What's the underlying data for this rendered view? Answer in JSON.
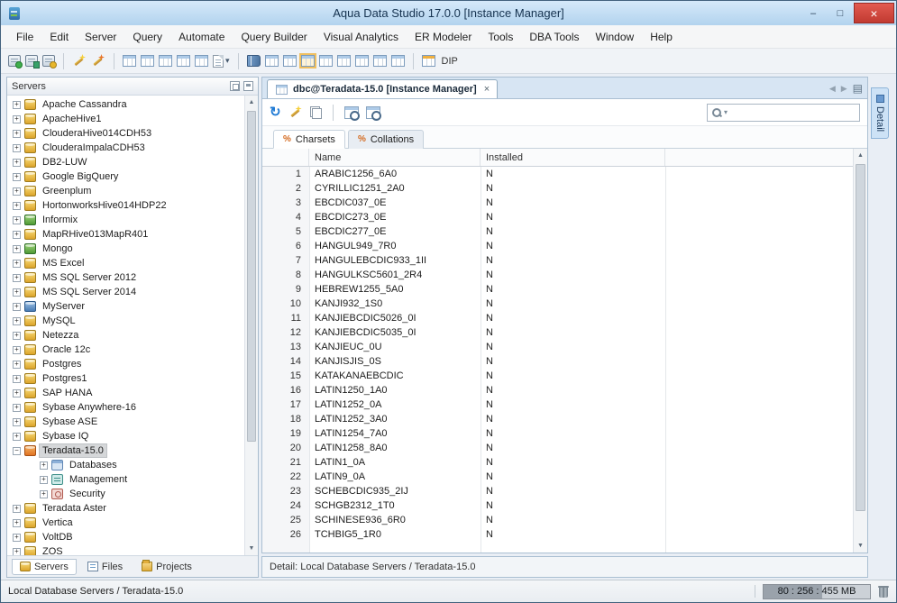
{
  "window": {
    "title": "Aqua Data Studio 17.0.0 [Instance Manager]",
    "controls": {
      "minimize": "–",
      "maximize": "□",
      "close": "×"
    }
  },
  "colors": {
    "titlebar": "#b8d6f0",
    "close_button": "#c9403a",
    "accent_blue": "#1f7ad4",
    "selection_gray": "#d5d7d9",
    "db_icon_yellow": "#dca42a",
    "detail_tab_blue": "#cde2f6"
  },
  "menu": {
    "items": [
      "File",
      "Edit",
      "Server",
      "Query",
      "Automate",
      "Query Builder",
      "Visual Analytics",
      "ER Modeler",
      "Tools",
      "DBA Tools",
      "Window",
      "Help"
    ]
  },
  "toolbar": {
    "dip_label": "DIP",
    "items": [
      {
        "name": "register-server-icon",
        "cls": "ico-server g"
      },
      {
        "name": "connect-server-icon",
        "cls": "ico-server f"
      },
      {
        "name": "server-properties-icon",
        "cls": "ico-server y"
      },
      {
        "type": "sep"
      },
      {
        "name": "query-analyzer-icon",
        "cls": "ico-wand"
      },
      {
        "name": "query-builder-icon",
        "cls": "ico-wand w2"
      },
      {
        "type": "sep"
      },
      {
        "name": "schema-browser-icon",
        "cls": "ico-grid"
      },
      {
        "name": "table-data-icon",
        "cls": "ico-grid"
      },
      {
        "name": "results-grid-icon",
        "cls": "ico-grid"
      },
      {
        "name": "pivot-grid-icon",
        "cls": "ico-grid"
      },
      {
        "name": "export-grid-icon",
        "cls": "ico-grid"
      },
      {
        "name": "new-document-icon",
        "cls": "ico-doc"
      },
      {
        "type": "caret",
        "name": "new-document-dropdown-caret"
      },
      {
        "type": "sep"
      },
      {
        "name": "instance-manager-icon",
        "cls": "ico-book"
      },
      {
        "name": "storage-view-icon",
        "cls": "ico-grid"
      },
      {
        "name": "sessions-view-icon",
        "cls": "ico-grid"
      },
      {
        "name": "security-view-icon",
        "cls": "ico-grid sel"
      },
      {
        "name": "charsets-view-icon",
        "cls": "ico-grid"
      },
      {
        "name": "collations-view-icon",
        "cls": "ico-grid"
      },
      {
        "name": "statistics-view-icon",
        "cls": "ico-grid"
      },
      {
        "name": "logs-view-icon",
        "cls": "ico-grid"
      },
      {
        "name": "configuration-view-icon",
        "cls": "ico-grid"
      },
      {
        "type": "sep"
      },
      {
        "name": "dip-icon",
        "cls": "ico-grid dipico"
      },
      {
        "type": "label"
      }
    ]
  },
  "sidebar": {
    "title": "Servers",
    "tree": [
      {
        "label": "Apache Cassandra",
        "icon": "db-yellow"
      },
      {
        "label": "ApacheHive1",
        "icon": "db-yellow"
      },
      {
        "label": "ClouderaHive014CDH53",
        "icon": "db-yellow"
      },
      {
        "label": "ClouderaImpalaCDH53",
        "icon": "db-yellow"
      },
      {
        "label": "DB2-LUW",
        "icon": "db-yellow"
      },
      {
        "label": "Google BigQuery",
        "icon": "db-yellow"
      },
      {
        "label": "Greenplum",
        "icon": "db-yellow"
      },
      {
        "label": "HortonworksHive014HDP22",
        "icon": "db-yellow"
      },
      {
        "label": "Informix",
        "icon": "db-green"
      },
      {
        "label": "MapRHive013MapR401",
        "icon": "db-yellow"
      },
      {
        "label": "Mongo",
        "icon": "db-green"
      },
      {
        "label": "MS Excel",
        "icon": "db-yellow"
      },
      {
        "label": "MS SQL Server 2012",
        "icon": "db-yellow"
      },
      {
        "label": "MS SQL Server 2014",
        "icon": "db-yellow"
      },
      {
        "label": "MyServer",
        "icon": "db-blue"
      },
      {
        "label": "MySQL",
        "icon": "db-yellow"
      },
      {
        "label": "Netezza",
        "icon": "db-yellow"
      },
      {
        "label": "Oracle 12c",
        "icon": "db-yellow"
      },
      {
        "label": "Postgres",
        "icon": "db-yellow"
      },
      {
        "label": "Postgres1",
        "icon": "db-yellow"
      },
      {
        "label": "SAP HANA",
        "icon": "db-yellow"
      },
      {
        "label": "Sybase Anywhere-16",
        "icon": "db-yellow"
      },
      {
        "label": "Sybase ASE",
        "icon": "db-yellow"
      },
      {
        "label": "Sybase IQ",
        "icon": "db-yellow"
      },
      {
        "label": "Teradata-15.0",
        "icon": "db-orange",
        "expander": "minus",
        "selected": true
      },
      {
        "label": "Databases",
        "icon": "folder-blue",
        "level": 1
      },
      {
        "label": "Management",
        "icon": "folder-teal",
        "level": 1
      },
      {
        "label": "Security",
        "icon": "folder-red",
        "level": 1
      },
      {
        "label": "Teradata Aster",
        "icon": "db-yellow"
      },
      {
        "label": "Vertica",
        "icon": "db-yellow"
      },
      {
        "label": "VoltDB",
        "icon": "db-yellow"
      },
      {
        "label": "ZOS",
        "icon": "db-yellow"
      }
    ],
    "tabs": [
      {
        "label": "Servers",
        "icon": "db-yellow",
        "active": true
      },
      {
        "label": "Files",
        "icon": "file-blue",
        "active": false
      },
      {
        "label": "Projects",
        "icon": "folder-yellow",
        "active": false
      }
    ]
  },
  "doc": {
    "tab": {
      "label": "dbc@Teradata-15.0 [Instance Manager]"
    },
    "search": {
      "value": "",
      "placeholder": ""
    },
    "subtabs": [
      {
        "label": "Charsets",
        "active": true
      },
      {
        "label": "Collations",
        "active": false
      }
    ],
    "table": {
      "columns": [
        "",
        "Name",
        "Installed"
      ],
      "rows": [
        [
          1,
          "ARABIC1256_6A0",
          "N"
        ],
        [
          2,
          "CYRILLIC1251_2A0",
          "N"
        ],
        [
          3,
          "EBCDIC037_0E",
          "N"
        ],
        [
          4,
          "EBCDIC273_0E",
          "N"
        ],
        [
          5,
          "EBCDIC277_0E",
          "N"
        ],
        [
          6,
          "HANGUL949_7R0",
          "N"
        ],
        [
          7,
          "HANGULEBCDIC933_1II",
          "N"
        ],
        [
          8,
          "HANGULKSC5601_2R4",
          "N"
        ],
        [
          9,
          "HEBREW1255_5A0",
          "N"
        ],
        [
          10,
          "KANJI932_1S0",
          "N"
        ],
        [
          11,
          "KANJIEBCDIC5026_0I",
          "N"
        ],
        [
          12,
          "KANJIEBCDIC5035_0I",
          "N"
        ],
        [
          13,
          "KANJIEUC_0U",
          "N"
        ],
        [
          14,
          "KANJISJIS_0S",
          "N"
        ],
        [
          15,
          "KATAKANAEBCDIC",
          "N"
        ],
        [
          16,
          "LATIN1250_1A0",
          "N"
        ],
        [
          17,
          "LATIN1252_0A",
          "N"
        ],
        [
          18,
          "LATIN1252_3A0",
          "N"
        ],
        [
          19,
          "LATIN1254_7A0",
          "N"
        ],
        [
          20,
          "LATIN1258_8A0",
          "N"
        ],
        [
          21,
          "LATIN1_0A",
          "N"
        ],
        [
          22,
          "LATIN9_0A",
          "N"
        ],
        [
          23,
          "SCHEBCDIC935_2IJ",
          "N"
        ],
        [
          24,
          "SCHGB2312_1T0",
          "N"
        ],
        [
          25,
          "SCHINESE936_6R0",
          "N"
        ],
        [
          26,
          "TCHBIG5_1R0",
          "N"
        ]
      ]
    },
    "detail_text": "Detail: Local Database Servers / Teradata-15.0"
  },
  "right_panel": {
    "tab": "Detail"
  },
  "statusbar": {
    "path": "Local Database Servers / Teradata-15.0",
    "memory": "80 : 256 : 455 MB"
  }
}
